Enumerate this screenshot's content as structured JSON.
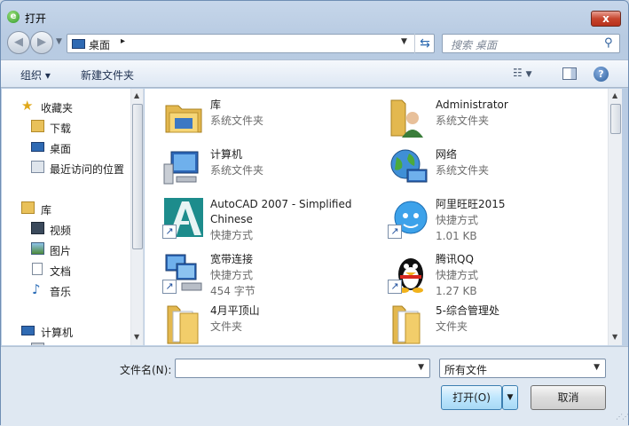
{
  "window": {
    "title": "打开",
    "close_label": "x"
  },
  "address_bar": {
    "location": "桌面",
    "separator": "▸"
  },
  "search": {
    "placeholder": "搜索 桌面"
  },
  "toolbar": {
    "organize": "组织 ▾",
    "new_folder": "新建文件夹"
  },
  "nav_pane": {
    "favorites": {
      "label": "收藏夹",
      "items": [
        "下载",
        "桌面",
        "最近访问的位置"
      ]
    },
    "libraries": {
      "label": "库",
      "items": [
        "视频",
        "图片",
        "文档",
        "音乐"
      ]
    },
    "computer": {
      "label": "计算机"
    }
  },
  "files": [
    {
      "name": "库",
      "type": "系统文件夹",
      "icon": "library-folder-icon"
    },
    {
      "name": "Administrator",
      "type": "系统文件夹",
      "icon": "user-folder-icon"
    },
    {
      "name": "计算机",
      "type": "系统文件夹",
      "icon": "computer-icon"
    },
    {
      "name": "网络",
      "type": "系统文件夹",
      "icon": "network-globe-icon"
    },
    {
      "name": "AutoCAD 2007 - Simplified Chinese",
      "type": "快捷方式",
      "icon": "autocad-icon"
    },
    {
      "name": "阿里旺旺2015",
      "type": "快捷方式",
      "size": "1.01 KB",
      "icon": "aliwangwang-icon"
    },
    {
      "name": "宽带连接",
      "type": "快捷方式",
      "size": "454 字节",
      "icon": "broadband-connection-icon"
    },
    {
      "name": "腾讯QQ",
      "type": "快捷方式",
      "size": "1.27 KB",
      "icon": "qq-penguin-icon"
    },
    {
      "name": "4月平顶山",
      "type": "文件夹",
      "icon": "folder-icon"
    },
    {
      "name": "5-综合管理处",
      "type": "文件夹",
      "icon": "folder-icon"
    }
  ],
  "bottom": {
    "filename_label": "文件名(N):",
    "filename_value": "",
    "filetype_value": "所有文件",
    "open_button": "打开(O)",
    "cancel_button": "取消"
  }
}
